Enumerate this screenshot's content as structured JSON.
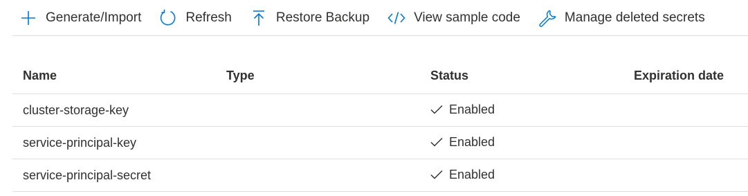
{
  "toolbar": {
    "items": [
      {
        "label": "Generate/Import",
        "icon": "plus-icon"
      },
      {
        "label": "Refresh",
        "icon": "refresh-icon"
      },
      {
        "label": "Restore Backup",
        "icon": "upload-arrow-icon"
      },
      {
        "label": "View sample code",
        "icon": "code-icon"
      },
      {
        "label": "Manage deleted secrets",
        "icon": "wrench-icon"
      }
    ]
  },
  "colors": {
    "accent": "#0078d4",
    "text": "#323130",
    "divider": "#e1dfdd"
  },
  "table": {
    "columns": [
      "Name",
      "Type",
      "Status",
      "Expiration date"
    ],
    "rows": [
      {
        "name": "cluster-storage-key",
        "type": "",
        "status": "Enabled",
        "expiration": ""
      },
      {
        "name": "service-principal-key",
        "type": "",
        "status": "Enabled",
        "expiration": ""
      },
      {
        "name": "service-principal-secret",
        "type": "",
        "status": "Enabled",
        "expiration": ""
      }
    ]
  }
}
